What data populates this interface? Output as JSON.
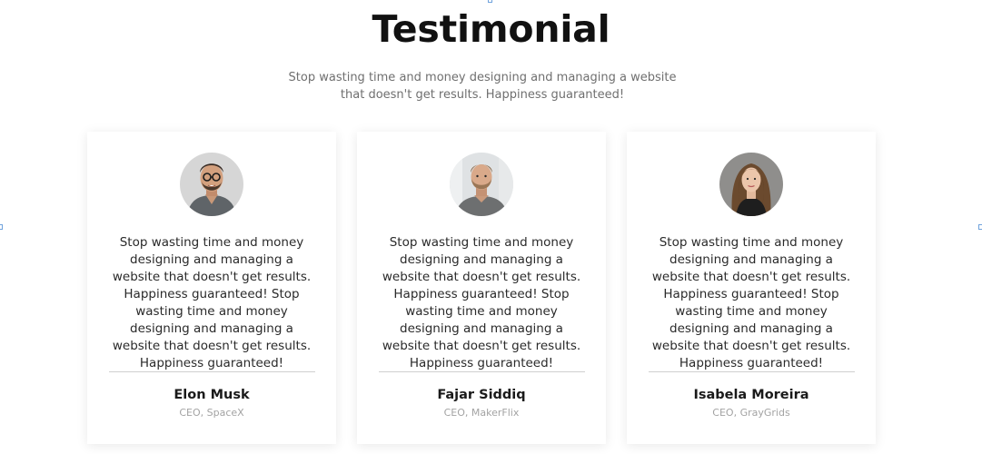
{
  "section": {
    "title": "Testimonial",
    "subtitle": "Stop wasting time and money designing and managing a website that doesn't get results. Happiness guaranteed!"
  },
  "testimonials": [
    {
      "quote": "Stop wasting time and money designing and managing a website that doesn't get results. Happiness guaranteed! Stop wasting time and money designing and managing a website that doesn't get results. Happiness guaranteed!",
      "name": "Elon Musk",
      "role": "CEO, SpaceX",
      "avatar": "man-with-glasses-photo"
    },
    {
      "quote": "Stop wasting time and money designing and managing a website that doesn't get results. Happiness guaranteed! Stop wasting time and money designing and managing a website that doesn't get results. Happiness guaranteed!",
      "name": "Fajar Siddiq",
      "role": "CEO, MakerFlix",
      "avatar": "bearded-man-photo"
    },
    {
      "quote": "Stop wasting time and money designing and managing a website that doesn't get results. Happiness guaranteed! Stop wasting time and money designing and managing a website that doesn't get results. Happiness guaranteed!",
      "name": "Isabela Moreira",
      "role": "CEO, GrayGrids",
      "avatar": "woman-long-hair-photo"
    }
  ],
  "colors": {
    "heading": "#111111",
    "subtitle": "#6f6f6f",
    "divider": "#cfcfcf",
    "role": "#a3a3a3"
  }
}
